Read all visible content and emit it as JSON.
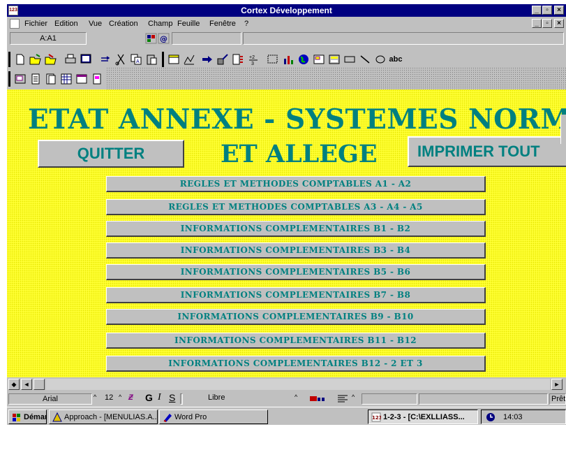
{
  "window": {
    "title": "Cortex Développement",
    "app_icon_text": "123"
  },
  "menubar": {
    "items": [
      {
        "label": "Fichier"
      },
      {
        "label": "Edition"
      },
      {
        "label": "Vue"
      },
      {
        "label": "Création"
      },
      {
        "label": "Champ"
      },
      {
        "label": "Feuille"
      },
      {
        "label": "Fenêtre"
      },
      {
        "label": "?"
      }
    ]
  },
  "cellbar": {
    "cell_reference": "A:A1"
  },
  "sheet": {
    "title": "ETAT ANNEXE - SYSTEMES NORMAL",
    "subtitle": "ET ALLEGE",
    "quit_label": "QUITTER",
    "print_all_label": "IMPRIMER TOUT",
    "buttons": [
      {
        "label": "REGLES ET METHODES COMPTABLES A1 - A2"
      },
      {
        "label": "REGLES ET METHODES COMPTABLES A3 - A4 - A5"
      },
      {
        "label": "INFORMATIONS COMPLEMENTAIRES B1 - B2"
      },
      {
        "label": "INFORMATIONS COMPLEMENTAIRES B3 - B4"
      },
      {
        "label": "INFORMATIONS COMPLEMENTAIRES B5 - B6"
      },
      {
        "label": "INFORMATIONS COMPLEMENTAIRES B7 - B8"
      },
      {
        "label": "INFORMATIONS COMPLEMENTAIRES B9 - B10"
      },
      {
        "label": "INFORMATIONS COMPLEMENTAIRES B11 - B12"
      },
      {
        "label": "INFORMATIONS COMPLEMENTAIRES B12 - 2  ET 3"
      }
    ]
  },
  "statusbar": {
    "font": "Arial",
    "size": "12",
    "bold": "G",
    "italic": "I",
    "underline": "S",
    "style": "Libre",
    "mode": "Prêt"
  },
  "taskbar": {
    "start": "Démarrer",
    "tasks": [
      {
        "label": "Approach - [MENULIAS.A..."
      },
      {
        "label": "Word Pro"
      },
      {
        "label": "1-2-3 - [C:\\EXLLIASS..."
      }
    ],
    "clock": "14:03"
  },
  "colors": {
    "title_bar": "#000080",
    "sheet_background": "#ffff33",
    "button_text": "#008080",
    "chrome": "#c0c0c0"
  }
}
